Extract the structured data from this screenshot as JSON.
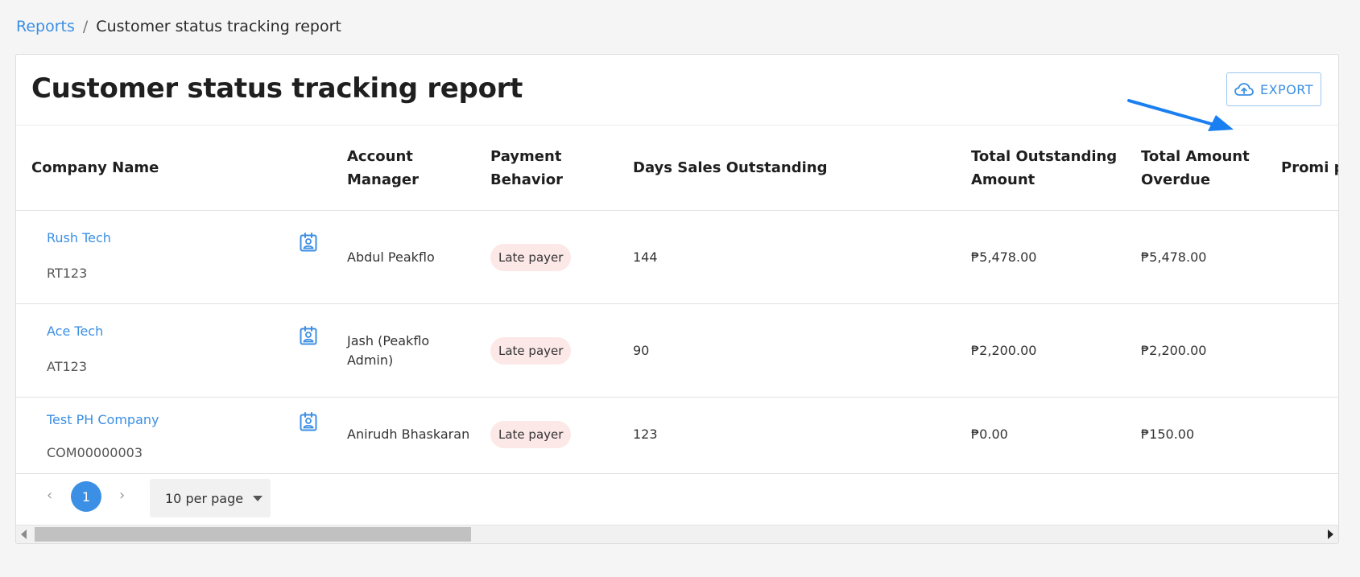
{
  "breadcrumb": {
    "root": "Reports",
    "separator": "/",
    "current": "Customer status tracking report"
  },
  "header": {
    "title": "Customer status tracking report",
    "export_label": "EXPORT"
  },
  "table": {
    "columns": [
      "Company Name",
      "Account Manager",
      "Payment Behavior",
      "Days Sales Outstanding",
      "Total Outstanding Amount",
      "Total Amount Overdue",
      "Promi pay ar"
    ],
    "rows": [
      {
        "company": "Rush Tech",
        "code": "RT123",
        "manager": "Abdul Peakflo",
        "behavior": "Late payer",
        "dso": "144",
        "outstanding": "₱5,478.00",
        "overdue": "₱5,478.00"
      },
      {
        "company": "Ace Tech",
        "code": "AT123",
        "manager": "Jash (Peakflo Admin)",
        "behavior": "Late payer",
        "dso": "90",
        "outstanding": "₱2,200.00",
        "overdue": "₱2,200.00"
      },
      {
        "company": "Test PH Company",
        "code": "COM00000003",
        "manager": "Anirudh Bhaskaran",
        "behavior": "Late payer",
        "dso": "123",
        "outstanding": "₱0.00",
        "overdue": "₱150.00"
      }
    ]
  },
  "pagination": {
    "current_page": "1",
    "per_page_label": "10 per page"
  },
  "colors": {
    "accent": "#3b8fe4",
    "badge_bg": "#fde8e8",
    "annotation_arrow": "#1a7ff0"
  },
  "icons": {
    "export": "cloud-upload-icon",
    "contact": "contact-card-icon",
    "prev": "chevron-left-icon",
    "next": "chevron-right-icon",
    "per_page": "caret-down-icon"
  }
}
